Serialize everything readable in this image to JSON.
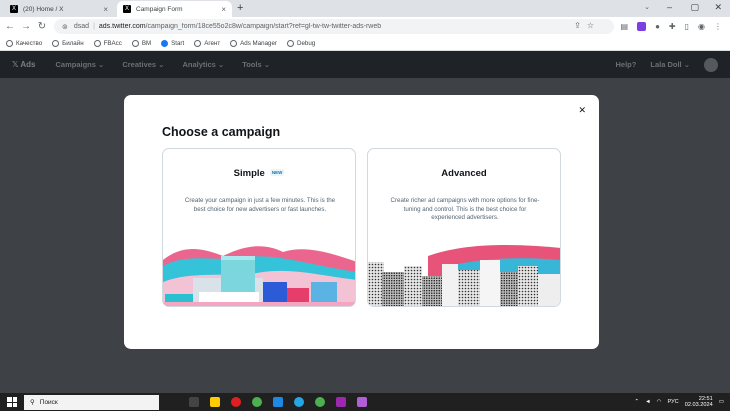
{
  "browser": {
    "tabs": [
      {
        "title": "(20) Home / X",
        "active": false
      },
      {
        "title": "Campaign Form",
        "active": true
      }
    ],
    "address": {
      "site": "dsad",
      "url_host": "ads.twitter.com",
      "url_path": "/campaign_form/18ce55o2c8w/campaign/start?ref=gl-tw-tw-twitter-ads-rweb"
    },
    "bookmarks": [
      {
        "label": "Качество",
        "icon": "globe-icon"
      },
      {
        "label": "Билайн",
        "icon": "globe-icon"
      },
      {
        "label": "FBAcc",
        "icon": "globe-icon"
      },
      {
        "label": "BM",
        "icon": "globe-icon"
      },
      {
        "label": "Start",
        "icon": "facebook-icon"
      },
      {
        "label": "Агент",
        "icon": "globe-icon"
      },
      {
        "label": "Ads Manager",
        "icon": "globe-icon"
      },
      {
        "label": "Debug",
        "icon": "globe-icon"
      }
    ]
  },
  "app": {
    "logo": "Ads",
    "menu": [
      "Campaigns",
      "Creatives",
      "Analytics",
      "Tools"
    ],
    "help": "Help?",
    "user": "Lala Doll"
  },
  "modal": {
    "title": "Choose a campaign",
    "cards": [
      {
        "title": "Simple",
        "badge": "NEW",
        "description": "Create your campaign in just a few minutes. This is the best choice for new advertisers or fast launches."
      },
      {
        "title": "Advanced",
        "badge": "",
        "description": "Create richer ad campaigns with more options for fine-tuning and control. This is the best choice for experienced advertisers."
      }
    ]
  },
  "taskbar": {
    "search_placeholder": "Поиск",
    "lang": "РУС",
    "time": "22:51",
    "date": "02.03.2024"
  },
  "colors": {
    "accent_blue": "#1d9bf0",
    "overlay": "#3e4246",
    "modal_bg": "#ffffff"
  }
}
